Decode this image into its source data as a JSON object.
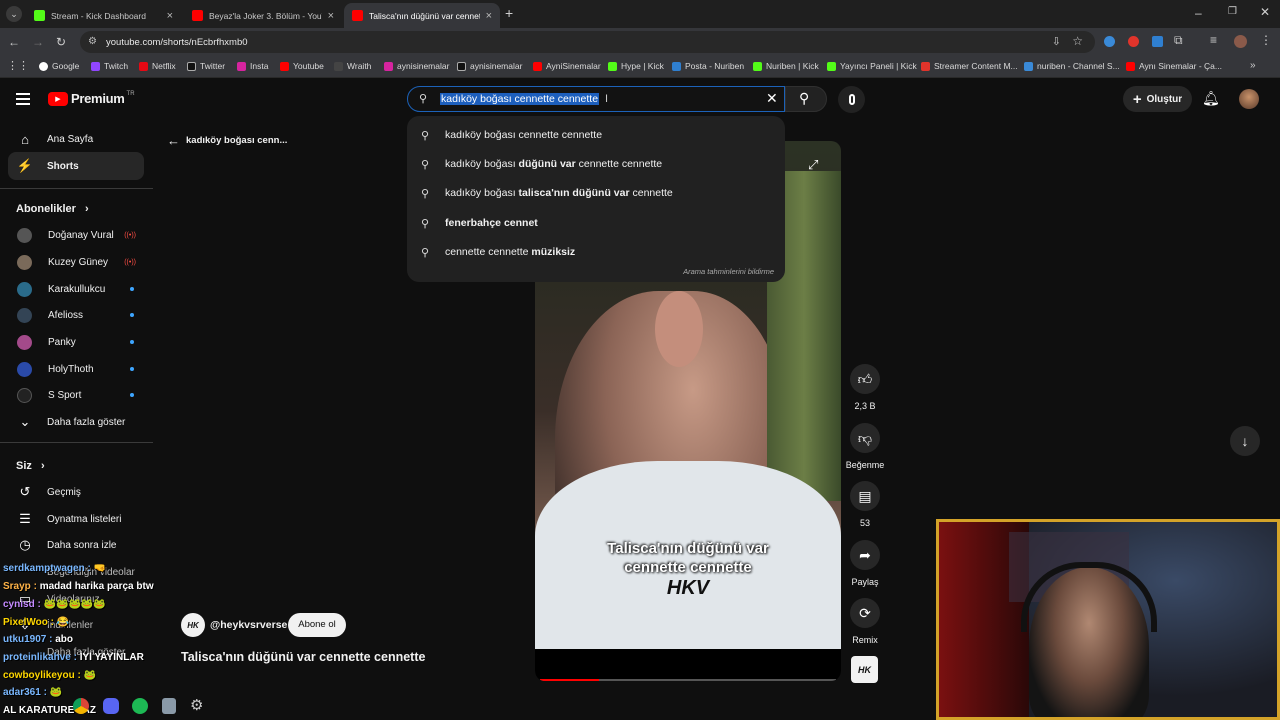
{
  "browser": {
    "tabs": [
      {
        "label": "Stream - Kick Dashboard",
        "color": "#53fc18"
      },
      {
        "label": "Beyaz'la Joker 3. Bölüm - YouTu",
        "color": "#ff0000"
      },
      {
        "label": "Talisca'nın düğünü var cennette",
        "color": "#ff0000"
      }
    ],
    "new_tab": "+",
    "url": "youtube.com/shorts/nEcbrfhxmb0",
    "bookmarks": [
      "Google",
      "Twitch",
      "Netflix",
      "Twitter",
      "Insta",
      "Youtube",
      "Wraith",
      "aynisinemalar",
      "aynisinemalar",
      "AyniSinemalar",
      "Hype | Kick",
      "Posta - Nuriben",
      "Nuriben | Kick",
      "Yayıncı Paneli | Kick",
      "Streamer Content M...",
      "nuriben - Channel S...",
      "Aynı Sinemalar - Ça..."
    ]
  },
  "youtube": {
    "logo": "Premium",
    "logo_region": "TR",
    "create_label": "Oluştur",
    "search": {
      "query": "kadıköy boğası cennette cennette",
      "suggestions": [
        {
          "plain": "kadıköy boğası cennette cennette",
          "bold": "",
          "tail": ""
        },
        {
          "plain": "kadıköy boğası ",
          "bold": "düğünü var",
          "tail": " cennette cennette"
        },
        {
          "plain": "kadıköy boğası ",
          "bold": "talisca'nın düğünü var",
          "tail": " cennette"
        },
        {
          "plain": "",
          "bold": "fenerbahçe cennet",
          "tail": ""
        },
        {
          "plain": "cennette cennette ",
          "bold": "müziksiz",
          "tail": ""
        }
      ],
      "report": "Arama tahminlerini bildirme"
    },
    "sidebar": {
      "home": "Ana Sayfa",
      "shorts": "Shorts",
      "subscriptions_title": "Abonelikler",
      "subscriptions": [
        {
          "name": "Doğanay Vural",
          "status": "live",
          "color": "#555"
        },
        {
          "name": "Kuzey Güney",
          "status": "live",
          "color": "#7a6a5a"
        },
        {
          "name": "Karakullukcu",
          "status": "new",
          "color": "#2a6b8a"
        },
        {
          "name": "Afelioss",
          "status": "new",
          "color": "#334455"
        },
        {
          "name": "Panky",
          "status": "new",
          "color": "#a34a8a"
        },
        {
          "name": "HolyThoth",
          "status": "new",
          "color": "#2a4aa8"
        },
        {
          "name": "S Sport",
          "status": "new",
          "color": "#222"
        }
      ],
      "more": "Daha fazla göster",
      "you_title": "Siz",
      "you_items": [
        "Geçmiş",
        "Oynatma listeleri",
        "Daha sonra izle"
      ],
      "partial_items": [
        "Beğendiğin videolar",
        "Videolarınız",
        "İndirilenler",
        "Daha fazla göster"
      ]
    },
    "back_title": "kadıköy boğası cenn...",
    "short": {
      "caption_line1": "Talisca'nın düğünü var",
      "caption_line2": "cennette cennette",
      "watermark": "HKV",
      "channel": "@heykvsrverse",
      "subscribe": "Abone ol",
      "title": "Talisca'nın düğünü var cennette cennette",
      "progress": 0.2
    },
    "actions": {
      "likes": "2,3 B",
      "dislike": "Beğenme",
      "comments": "53",
      "share": "Paylaş",
      "remix": "Remix"
    }
  },
  "chat": [
    {
      "user": "serdkamptwagen :",
      "msg": "🤜",
      "color": "#7ab8ff"
    },
    {
      "user": "Srayp :",
      "msg": "madad harika parça btw",
      "color": "#ffb347"
    },
    {
      "user": "cynisd :",
      "msg": "🐸🐸🐸🐸🐸",
      "color": "#c48aff"
    },
    {
      "user": "PixelWoo :",
      "msg": "😂",
      "color": "#ffd700"
    },
    {
      "user": "utku1907 :",
      "msg": "abo",
      "color": "#7ab8ff"
    },
    {
      "user": "proteinlikahve :",
      "msg": "İYİ YAYINLAR",
      "color": "#7ab8ff"
    },
    {
      "user": "cowboylikeyou :",
      "msg": "🐸",
      "color": "#ffd700"
    },
    {
      "user": "adar361 :",
      "msg": "🐸",
      "color": "#7ab8ff"
    },
    {
      "user": "AL KARATURE YAZ",
      "msg": "",
      "color": "#ffffff"
    }
  ],
  "colors": {
    "accent": "#ff0000",
    "link": "#3ea6ff",
    "cam_border": "#d4a329"
  }
}
